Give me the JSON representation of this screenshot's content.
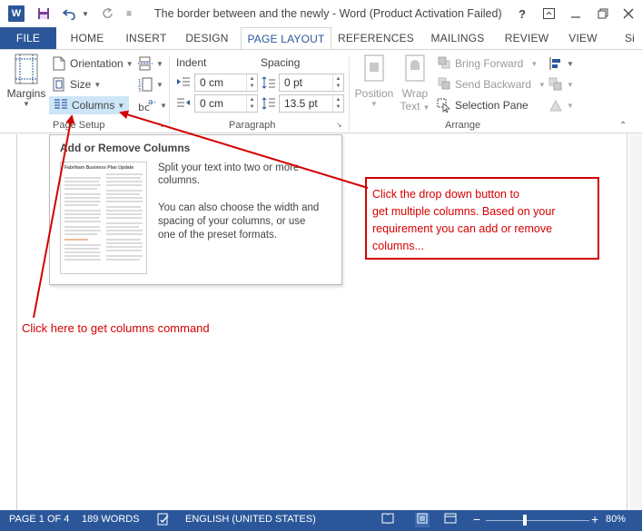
{
  "window": {
    "title": "The border between and the newly - Word (Product Activation Failed)",
    "app_icon": "W",
    "help_label": "?",
    "accent": "#2b579a"
  },
  "tabs": [
    {
      "label": "FILE",
      "name": "tab-file"
    },
    {
      "label": "HOME",
      "name": "tab-home"
    },
    {
      "label": "INSERT",
      "name": "tab-insert"
    },
    {
      "label": "DESIGN",
      "name": "tab-design"
    },
    {
      "label": "PAGE LAYOUT",
      "name": "tab-page-layout",
      "active": true
    },
    {
      "label": "REFERENCES",
      "name": "tab-references"
    },
    {
      "label": "MAILINGS",
      "name": "tab-mailings"
    },
    {
      "label": "REVIEW",
      "name": "tab-review"
    },
    {
      "label": "VIEW",
      "name": "tab-view"
    },
    {
      "label": "Si",
      "name": "sign-in"
    }
  ],
  "ribbon": {
    "page_setup": {
      "label": "Page Setup",
      "margins": "Margins",
      "orientation": "Orientation",
      "size": "Size",
      "columns": "Columns"
    },
    "paragraph": {
      "label": "Paragraph",
      "indent_label": "Indent",
      "spacing_label": "Spacing",
      "indent_left": "0 cm",
      "indent_right": "0 cm",
      "spacing_before": "0 pt",
      "spacing_after": "13.5 pt"
    },
    "arrange": {
      "label": "Arrange",
      "position": "Position",
      "wrap_text_1": "Wrap",
      "wrap_text_2": "Text",
      "bring_forward": "Bring Forward",
      "send_backward": "Send Backward",
      "selection_pane": "Selection Pane"
    }
  },
  "tooltip": {
    "title": "Add or Remove Columns",
    "line1": "Split your text into two or more",
    "line2": "columns.",
    "line3": "You can also choose the width and",
    "line4": "spacing of your columns, or use",
    "line5": "one of the preset formats.",
    "thumb_heading": "Fabrikam Business Plan Update"
  },
  "annotations": {
    "callout_lines": [
      "Click the drop down button to",
      "get multiple columns. Based on your",
      "requirement you can add or remove",
      "columns..."
    ],
    "hint": "Click here to get columns command",
    "color": "#d40000"
  },
  "statusbar": {
    "page": "PAGE 1 OF 4",
    "words": "189 WORDS",
    "language": "ENGLISH (UNITED STATES)",
    "minus": "−",
    "plus": "+",
    "zoom": "80%",
    "zoom_level_percent": 80
  }
}
